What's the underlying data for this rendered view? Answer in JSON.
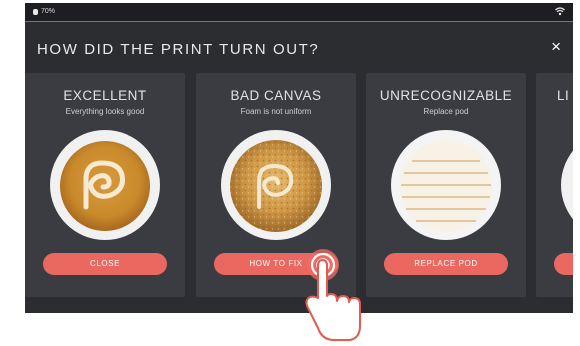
{
  "status": {
    "battery": "70%"
  },
  "header": {
    "title": "HOW DID THE PRINT TURN OUT?",
    "close_symbol": "×"
  },
  "cards": [
    {
      "title": "EXCELLENT",
      "subtitle": "Everything looks good",
      "button": "CLOSE"
    },
    {
      "title": "BAD CANVAS",
      "subtitle": "Foam is not uniform",
      "button": "HOW TO FIX"
    },
    {
      "title": "UNRECOGNIZABLE",
      "subtitle": "Replace pod",
      "button": "REPLACE POD"
    },
    {
      "title": "LI"
    }
  ],
  "colors": {
    "accent_button": "#ea6860",
    "panel": "#2b2d31",
    "card": "#3a3c42"
  },
  "icons": {
    "battery": "battery-icon",
    "wifi": "wifi-icon",
    "close": "close-icon",
    "tap": "tap-hand-icon"
  }
}
